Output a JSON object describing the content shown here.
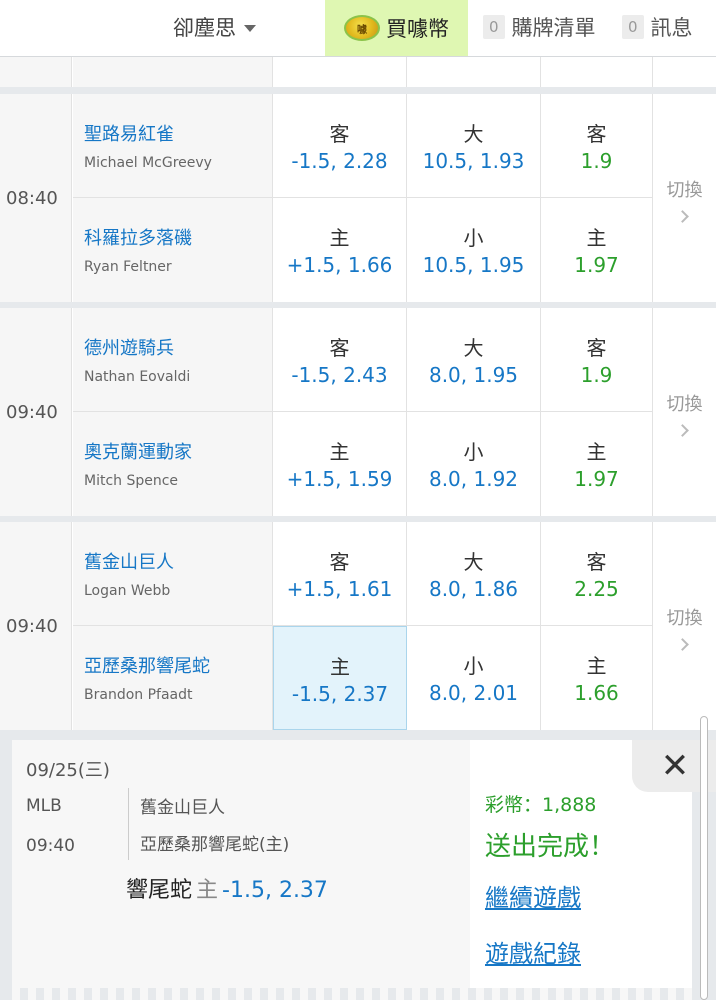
{
  "header": {
    "user": "卻塵思",
    "buy_label": "買噱幣",
    "coin_glyph": "噱",
    "cart_count": "0",
    "cart_label": "購牌清單",
    "msg_count": "0",
    "msg_label": "訊息"
  },
  "games": [
    {
      "time": "08:40",
      "switch_label": "切換",
      "teams": [
        {
          "name": "聖路易紅雀",
          "pitcher": "Michael McGreevy",
          "spread_side": "客",
          "spread": "-1.5, 2.28",
          "total_side": "大",
          "total": "10.5, 1.93",
          "ml_side": "客",
          "ml": "1.9"
        },
        {
          "name": "科羅拉多落磯",
          "pitcher": "Ryan Feltner",
          "spread_side": "主",
          "spread": "+1.5, 1.66",
          "total_side": "小",
          "total": "10.5, 1.95",
          "ml_side": "主",
          "ml": "1.97"
        }
      ]
    },
    {
      "time": "09:40",
      "switch_label": "切換",
      "teams": [
        {
          "name": "德州遊騎兵",
          "pitcher": "Nathan Eovaldi",
          "spread_side": "客",
          "spread": "-1.5, 2.43",
          "total_side": "大",
          "total": "8.0, 1.95",
          "ml_side": "客",
          "ml": "1.9"
        },
        {
          "name": "奧克蘭運動家",
          "pitcher": "Mitch Spence",
          "spread_side": "主",
          "spread": "+1.5, 1.59",
          "total_side": "小",
          "total": "8.0, 1.92",
          "ml_side": "主",
          "ml": "1.97"
        }
      ]
    },
    {
      "time": "09:40",
      "switch_label": "切換",
      "teams": [
        {
          "name": "舊金山巨人",
          "pitcher": "Logan Webb",
          "spread_side": "客",
          "spread": "+1.5, 1.61",
          "total_side": "大",
          "total": "8.0, 1.86",
          "ml_side": "客",
          "ml": "2.25"
        },
        {
          "name": "亞歷桑那響尾蛇",
          "pitcher": "Brandon Pfaadt",
          "spread_side": "主",
          "spread": "-1.5, 2.37",
          "total_side": "小",
          "total": "8.0, 2.01",
          "ml_side": "主",
          "ml": "1.66"
        }
      ]
    }
  ],
  "ticket": {
    "date": "09/25(三)",
    "league": "MLB",
    "time": "09:40",
    "team_away": "舊金山巨人",
    "team_home": "亞歷桑那響尾蛇(主)",
    "pick_name": "響尾蛇",
    "pick_side": "主",
    "pick_odds": "-1.5, 2.37",
    "credit": "彩幣：1,888",
    "done": "送出完成！",
    "continue_link": "繼續遊戲",
    "history_link": "遊戲紀錄",
    "close_glyph": "✕"
  },
  "colors": {
    "link_blue": "#1677c6",
    "odds_green": "#2c9f2c",
    "buy_bg": "#dff7b2"
  }
}
